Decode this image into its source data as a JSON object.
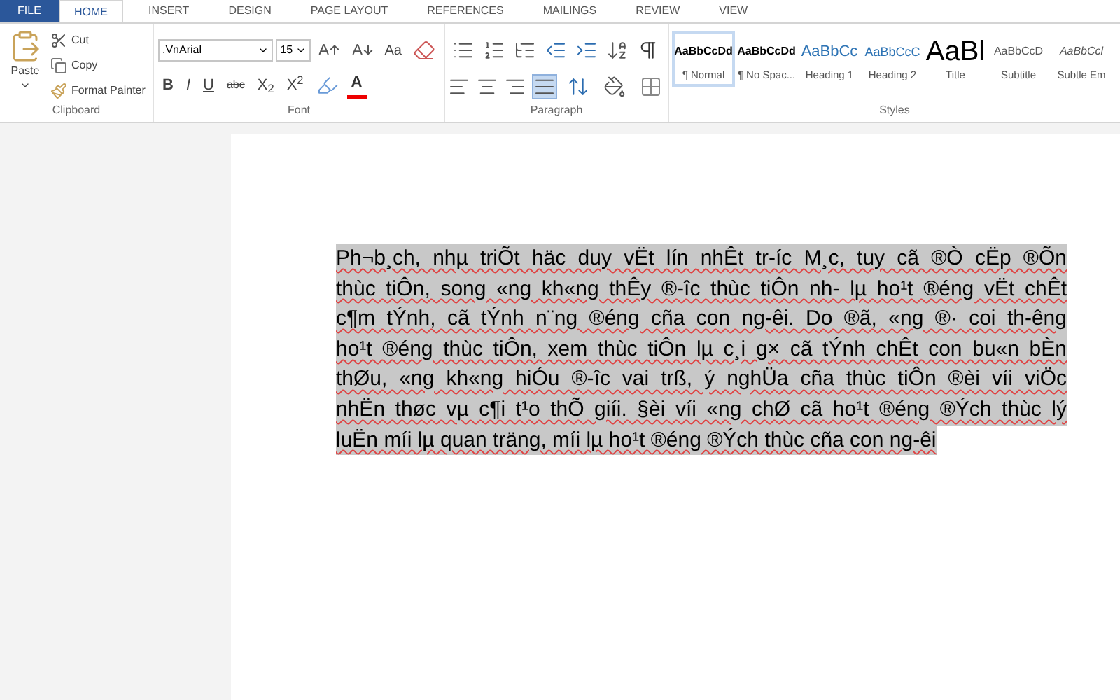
{
  "tabs": [
    {
      "label": "FILE",
      "kind": "file",
      "selected": false
    },
    {
      "label": "HOME",
      "kind": "tab",
      "selected": true
    },
    {
      "label": "INSERT",
      "kind": "tab",
      "selected": false
    },
    {
      "label": "DESIGN",
      "kind": "tab",
      "selected": false
    },
    {
      "label": "PAGE LAYOUT",
      "kind": "tab",
      "selected": false
    },
    {
      "label": "REFERENCES",
      "kind": "tab",
      "selected": false
    },
    {
      "label": "MAILINGS",
      "kind": "tab",
      "selected": false
    },
    {
      "label": "REVIEW",
      "kind": "tab",
      "selected": false
    },
    {
      "label": "VIEW",
      "kind": "tab",
      "selected": false
    }
  ],
  "clipboard": {
    "paste": "Paste",
    "cut": "Cut",
    "copy": "Copy",
    "format_painter": "Format Painter",
    "label": "Clipboard"
  },
  "font": {
    "name": ".VnArial",
    "size": "15",
    "change_case": "Aa",
    "bold": "B",
    "italic": "I",
    "underline": "U",
    "strikethrough": "abc",
    "subscript": "X$_{2}$",
    "superscript": "X$^{2}$",
    "font_color": "A",
    "label": "Font"
  },
  "paragraph": {
    "alignments": [
      {
        "kind": "left",
        "selected": false
      },
      {
        "kind": "center",
        "selected": false
      },
      {
        "kind": "right",
        "selected": false
      },
      {
        "kind": "justify",
        "selected": true
      }
    ],
    "label": "Paragraph"
  },
  "styles": {
    "items": [
      {
        "preview": "AaBbCcDd",
        "name": "¶ Normal",
        "kind": "normal",
        "selected": true
      },
      {
        "preview": "AaBbCcDd",
        "name": "¶ No Spac...",
        "kind": "nospacing",
        "selected": false
      },
      {
        "preview": "AaBbCc",
        "name": "Heading 1",
        "kind": "heading1",
        "selected": false
      },
      {
        "preview": "AaBbCcC",
        "name": "Heading 2",
        "kind": "heading2",
        "selected": false
      },
      {
        "preview": "AaBl",
        "name": "Title",
        "kind": "title",
        "selected": false
      },
      {
        "preview": "AaBbCcD",
        "name": "Subtitle",
        "kind": "subtitle",
        "selected": false
      },
      {
        "preview": "AaBbCcl",
        "name": "Subtle Em",
        "kind": "subtle",
        "selected": false
      }
    ],
    "label": "Styles"
  },
  "document": {
    "selected": true,
    "lines": [
      "Ph¬b¸ch, nhµ triÕt häc duy vËt lín nhÊt tr-íc M¸c, tuy cã ®Ò cËp ®Õn",
      "thùc tiÔn, song «ng kh«ng thÊy ®-îc thùc tiÔn nh- lµ ho¹t ®éng vËt chÊt",
      "c¶m tÝnh, cã tÝnh n¨ng ®éng cña con ng-êi. Do ®ã, «ng ®· coi th-êng",
      "ho¹t ®éng thùc tiÔn, xem thùc tiÔn lµ c¸i g× cã tÝnh chÊt con bu«n bÈn",
      "thØu, «ng kh«ng hiÓu ®-îc vai trß, ý nghÜa cña thùc tiÔn ®èi víi viÖc",
      "nhËn thøc vµ c¶i t¹o thÕ giíi. §èi víi «ng chØ cã ho¹t ®éng ®Ých thùc lý",
      "luËn míi lµ quan träng, míi lµ ho¹t ®éng ®Ých thùc cña con ng-êi"
    ]
  }
}
